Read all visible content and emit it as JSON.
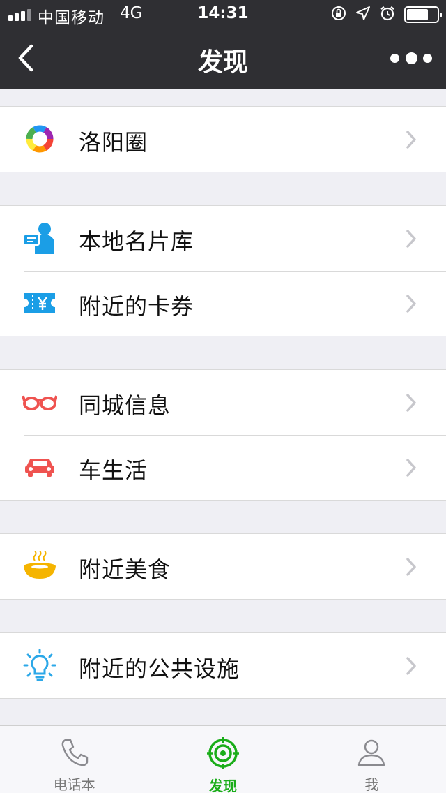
{
  "status_bar": {
    "carrier": "中国移动",
    "network": "4G",
    "time": "14:31",
    "signal_bars": 3,
    "signal_max": 4,
    "battery_level": 0.72,
    "icons": [
      "rotation-lock-icon",
      "location-arrow-icon",
      "alarm-icon",
      "battery-icon"
    ]
  },
  "nav": {
    "title": "发现",
    "back_icon": "chevron-left-icon",
    "more_icon": "more-dots-icon"
  },
  "groups": [
    {
      "items": [
        {
          "label": "洛阳圈",
          "icon": "circle-moments-icon"
        }
      ]
    },
    {
      "items": [
        {
          "label": "本地名片库",
          "icon": "business-card-icon"
        },
        {
          "label": "附近的卡券",
          "icon": "coupon-ticket-icon"
        }
      ]
    },
    {
      "items": [
        {
          "label": "同城信息",
          "icon": "glasses-icon"
        },
        {
          "label": "车生活",
          "icon": "car-icon"
        }
      ]
    },
    {
      "items": [
        {
          "label": "附近美食",
          "icon": "hot-bowl-icon"
        }
      ]
    },
    {
      "items": [
        {
          "label": "附近的公共设施",
          "icon": "light-bulb-icon"
        }
      ]
    }
  ],
  "tabbar": {
    "tabs": [
      {
        "label": "电话本",
        "icon": "phone-icon",
        "active": false
      },
      {
        "label": "发现",
        "icon": "target-icon",
        "active": true
      },
      {
        "label": "我",
        "icon": "person-icon",
        "active": false
      }
    ]
  },
  "colors": {
    "nav_bg": "#2f2f33",
    "page_bg": "#efeff4",
    "active_tab": "#1aad19",
    "card_icon_blue": "#1b9ee6",
    "red_icon": "#ef5350",
    "food_yellow": "#f5b400",
    "bulb_blue": "#2ca8e8"
  }
}
